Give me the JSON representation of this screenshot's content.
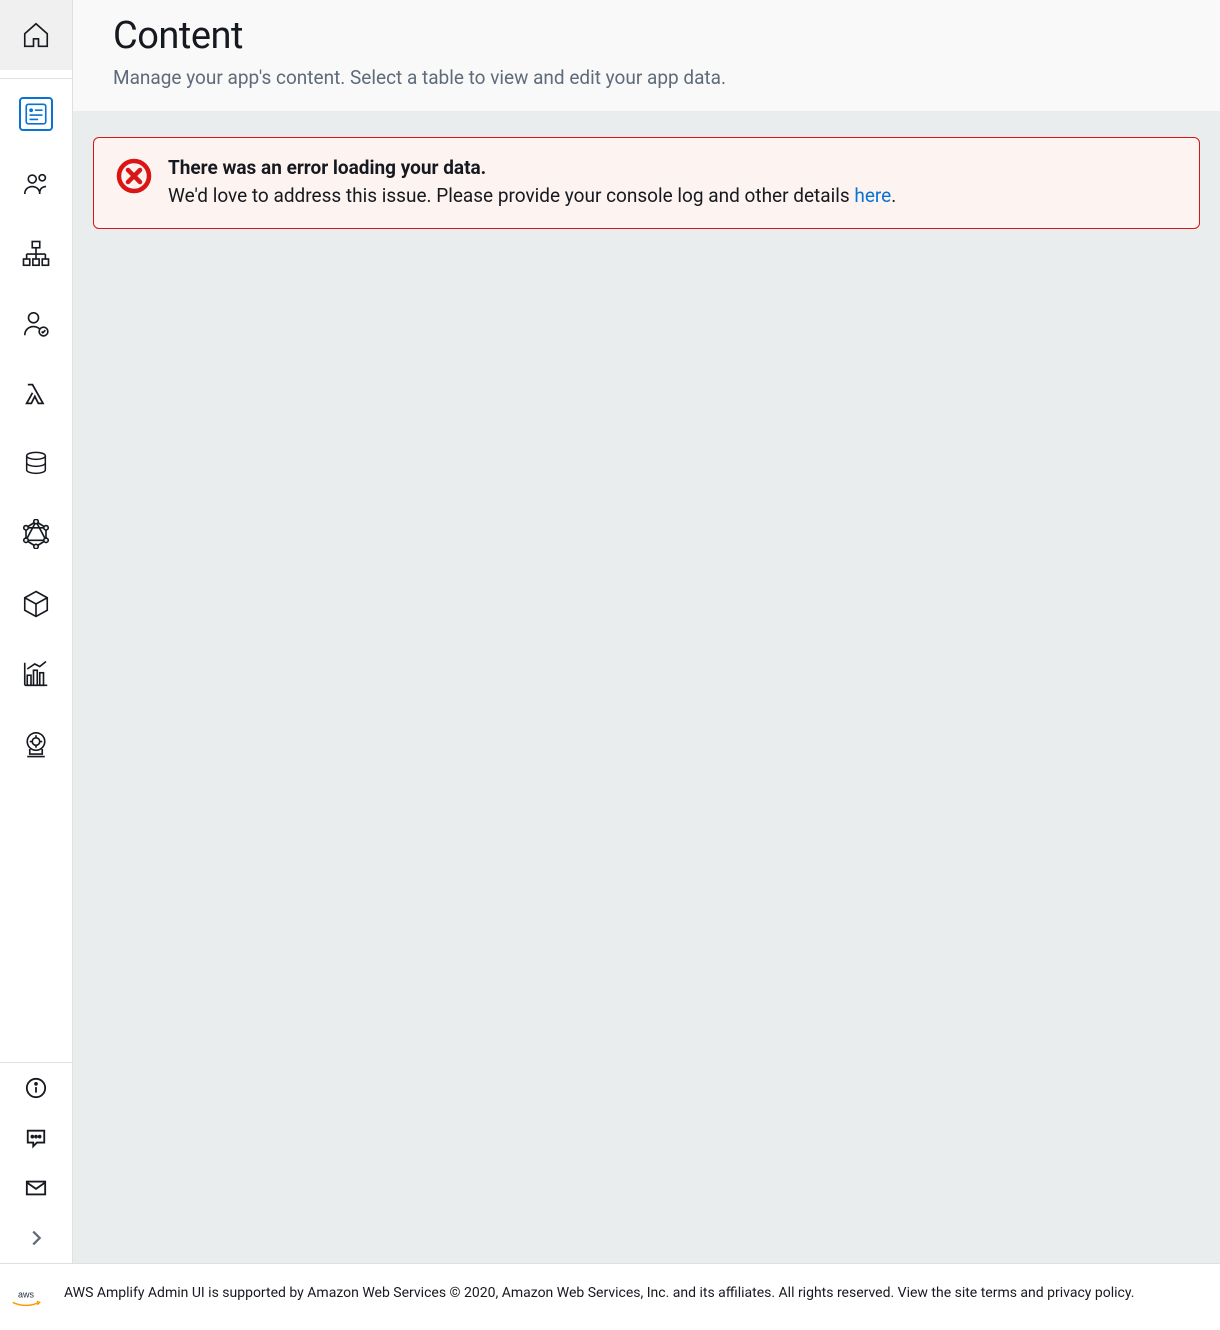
{
  "header": {
    "title": "Content",
    "subtitle": "Manage your app's content. Select a table to view and edit your app data."
  },
  "alert": {
    "title": "There was an error loading your data.",
    "message_prefix": "We'd love to address this issue. Please provide your console log and other details ",
    "link_text": "here",
    "message_suffix": "."
  },
  "footer": {
    "logo_text": "aws",
    "text_prefix": "AWS Amplify Admin UI is supported by Amazon Web Services © 2020, Amazon Web Services, Inc. and its affiliates. All rights reserved. View the ",
    "site_terms": "site terms",
    "and": " and ",
    "privacy_policy": "privacy policy",
    "text_suffix": "."
  },
  "sidebar": {
    "home": "home",
    "content": "content",
    "users": "users",
    "data": "data-model",
    "auth": "authentication",
    "functions": "functions",
    "storage": "storage",
    "graphql": "graphql",
    "rest": "rest-api",
    "analytics": "analytics",
    "predictions": "predictions",
    "info": "info",
    "feedback": "feedback",
    "contact": "contact",
    "expand": "expand"
  }
}
